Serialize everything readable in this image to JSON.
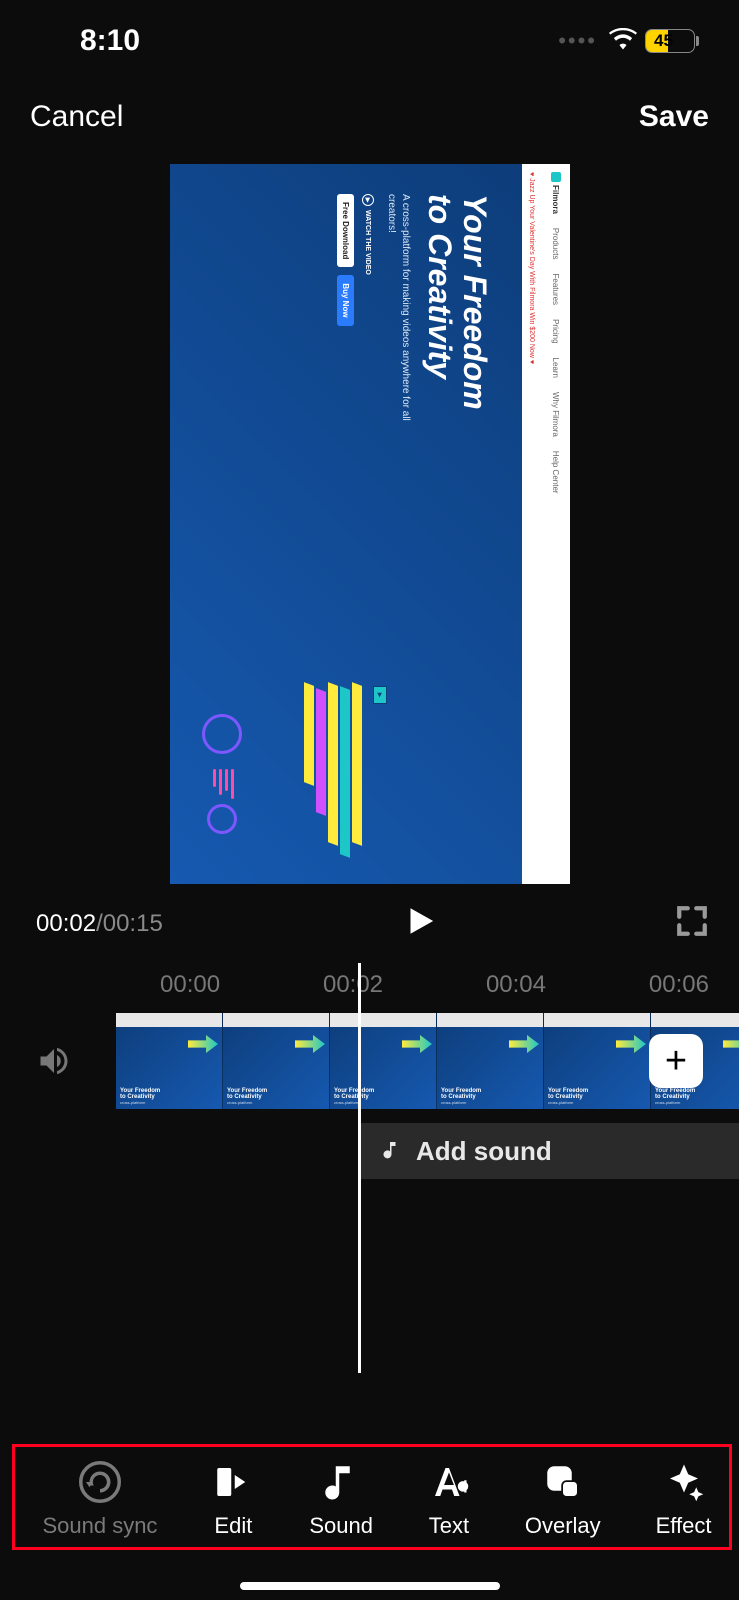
{
  "status": {
    "time": "8:10",
    "battery_pct": "45"
  },
  "header": {
    "cancel_label": "Cancel",
    "save_label": "Save"
  },
  "preview": {
    "site_nav": {
      "brand": "Filmora",
      "items": [
        "Products",
        "Features",
        "Pricing",
        "Learn",
        "Why Filmora",
        "Help Center"
      ]
    },
    "banner": "♥ Jazz Up Your Valentine's Day With Filmora Win $200 Now ♥",
    "hero_title_line1": "Your Freedom",
    "hero_title_line2": "to Creativity",
    "hero_sub": "A cross-platform for making videos anywhere for all creators!",
    "hero_watch": "WATCH THE VIDEO",
    "btn_download": "Free Download",
    "btn_buy": "Buy Now"
  },
  "playback": {
    "current": "00:02",
    "total": "00:15"
  },
  "ruler": {
    "marks": [
      "00:00",
      "00:02",
      "00:04",
      "00:06"
    ]
  },
  "sound_row": {
    "add_label": "Add sound"
  },
  "toolbar": {
    "items": [
      {
        "label": "Sound sync"
      },
      {
        "label": "Edit"
      },
      {
        "label": "Sound"
      },
      {
        "label": "Text"
      },
      {
        "label": "Overlay"
      },
      {
        "label": "Effect"
      }
    ]
  }
}
